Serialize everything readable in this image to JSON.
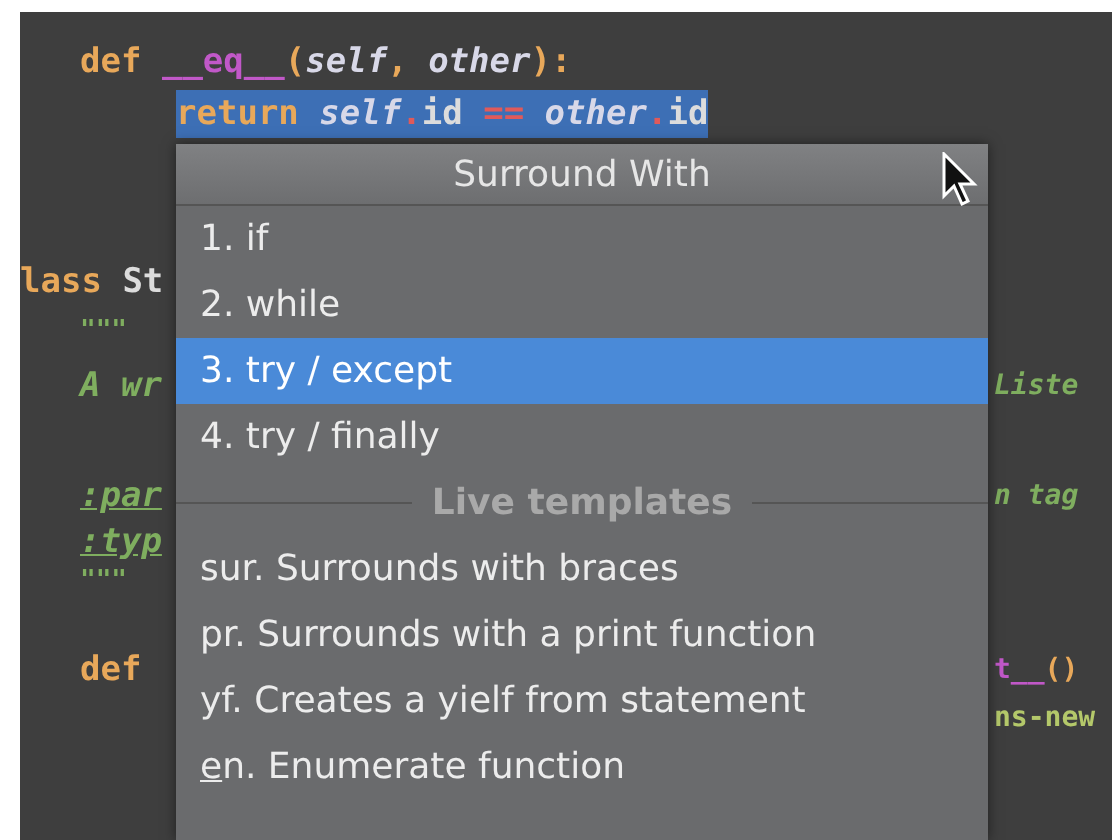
{
  "editor": {
    "lines": [
      {
        "selected": false,
        "tokens": [
          {
            "kind": "keyword",
            "text": "def "
          },
          {
            "kind": "magic",
            "text": "__eq__"
          },
          {
            "kind": "punct",
            "text": "("
          },
          {
            "kind": "param",
            "text": "self"
          },
          {
            "kind": "punct",
            "text": ", "
          },
          {
            "kind": "param",
            "text": "other"
          },
          {
            "kind": "punct",
            "text": "):"
          }
        ]
      },
      {
        "selected": true,
        "tokens": [
          {
            "kind": "keyword",
            "text": "return "
          },
          {
            "kind": "param",
            "text": "self"
          },
          {
            "kind": "op",
            "text": "."
          },
          {
            "kind": "plain",
            "text": "id "
          },
          {
            "kind": "op",
            "text": "== "
          },
          {
            "kind": "param",
            "text": "other"
          },
          {
            "kind": "op",
            "text": "."
          },
          {
            "kind": "plain",
            "text": "id"
          }
        ]
      },
      {
        "selected": false,
        "tokens": [
          {
            "kind": "keyword",
            "text": "lass"
          },
          {
            "kind": "plain",
            "text": " St"
          }
        ]
      },
      {
        "selected": false,
        "tokens": [
          {
            "kind": "docquote",
            "text": "\"\"\""
          }
        ]
      },
      {
        "selected": false,
        "tokens": [
          {
            "kind": "doc",
            "text": "A wr"
          }
        ],
        "right": [
          {
            "kind": "doc",
            "text": "Liste"
          }
        ]
      },
      {
        "selected": false,
        "tokens": [
          {
            "kind": "doctag",
            "text": ":par"
          }
        ],
        "right": [
          {
            "kind": "doc",
            "text": "n tag"
          }
        ]
      },
      {
        "selected": false,
        "tokens": [
          {
            "kind": "doctag",
            "text": ":typ"
          }
        ]
      },
      {
        "selected": false,
        "tokens": [
          {
            "kind": "docquote",
            "text": "\"\"\""
          }
        ]
      },
      {
        "selected": false,
        "tokens": [
          {
            "kind": "keyword",
            "text": "def"
          }
        ],
        "right": [
          {
            "kind": "magic",
            "text": "t__"
          },
          {
            "kind": "punct",
            "text": "()"
          }
        ]
      },
      {
        "selected": false,
        "right": [
          {
            "kind": "string",
            "text": "ns-new"
          }
        ]
      }
    ]
  },
  "popup": {
    "title": "Surround With",
    "items": [
      {
        "label": "1. if",
        "selected": false
      },
      {
        "label": "2. while",
        "selected": false
      },
      {
        "label": "3. try / except",
        "selected": true
      },
      {
        "label": "4. try / finally",
        "selected": false
      }
    ],
    "section": "Live templates",
    "templates": [
      {
        "label": "sur. Surrounds with braces",
        "mnemonic_underlined": false
      },
      {
        "label": "pr. Surrounds with a print function",
        "mnemonic_underlined": false
      },
      {
        "label": "yf. Creates a yielf from statement",
        "mnemonic_underlined": false
      },
      {
        "label": "en. Enumerate function",
        "mnemonic_underlined": true
      }
    ]
  }
}
